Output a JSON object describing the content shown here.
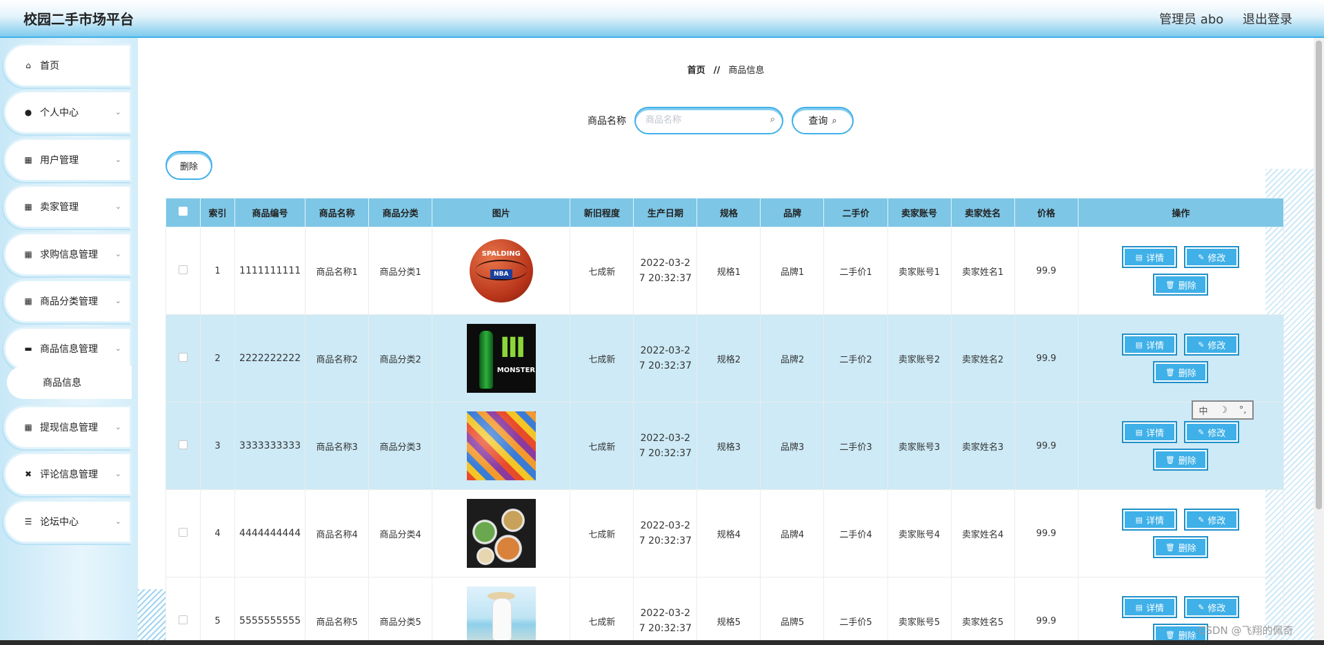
{
  "header": {
    "app_title": "校园二手市场平台",
    "user_label": "管理员 abo",
    "logout_label": "退出登录"
  },
  "sidebar": {
    "items": [
      {
        "label": "首页",
        "icon": "home-icon",
        "glyph": "⌂",
        "has_chevron": false
      },
      {
        "label": "个人中心",
        "icon": "person-icon",
        "glyph": "●",
        "has_chevron": true
      },
      {
        "label": "用户管理",
        "icon": "grid-icon",
        "glyph": "▦",
        "has_chevron": true
      },
      {
        "label": "卖家管理",
        "icon": "grid-icon",
        "glyph": "▦",
        "has_chevron": true
      },
      {
        "label": "求购信息管理",
        "icon": "grid-icon",
        "glyph": "▦",
        "has_chevron": true
      },
      {
        "label": "商品分类管理",
        "icon": "grid-icon",
        "glyph": "▦",
        "has_chevron": true
      },
      {
        "label": "商品信息管理",
        "icon": "chat-icon",
        "glyph": "▬",
        "has_chevron": true
      },
      {
        "label": "提现信息管理",
        "icon": "grid-icon",
        "glyph": "▦",
        "has_chevron": true
      },
      {
        "label": "评论信息管理",
        "icon": "ticket-icon",
        "glyph": "✖",
        "has_chevron": true
      },
      {
        "label": "论坛中心",
        "icon": "list-icon",
        "glyph": "☰",
        "has_chevron": true
      }
    ],
    "sub_item": "商品信息"
  },
  "breadcrumb": {
    "home": "首页",
    "separator": "//",
    "current": "商品信息"
  },
  "search": {
    "label": "商品名称",
    "placeholder": "商品名称",
    "value": "",
    "button_label": "查询"
  },
  "toolbar": {
    "delete_label": "删除"
  },
  "table": {
    "columns": [
      "索引",
      "商品编号",
      "商品名称",
      "商品分类",
      "图片",
      "新旧程度",
      "生产日期",
      "规格",
      "品牌",
      "二手价",
      "卖家账号",
      "卖家姓名",
      "价格",
      "操作"
    ],
    "actions": {
      "detail": "详情",
      "edit": "修改",
      "delete": "删除"
    },
    "rows": [
      {
        "index": "1",
        "code": "1111111111",
        "name": "商品名称1",
        "category": "商品分类1",
        "image": "basketball-image",
        "condition": "七成新",
        "date": "2022-03-27 20:32:37",
        "spec": "规格1",
        "brand": "品牌1",
        "used_price": "二手价1",
        "seller_account": "卖家账号1",
        "seller_name": "卖家姓名1",
        "price": "99.9"
      },
      {
        "index": "2",
        "code": "2222222222",
        "name": "商品名称2",
        "category": "商品分类2",
        "image": "energy-drink-image",
        "condition": "七成新",
        "date": "2022-03-27 20:32:37",
        "spec": "规格2",
        "brand": "品牌2",
        "used_price": "二手价2",
        "seller_account": "卖家账号2",
        "seller_name": "卖家姓名2",
        "price": "99.9"
      },
      {
        "index": "3",
        "code": "3333333333",
        "name": "商品名称3",
        "category": "商品分类3",
        "image": "snacks-image",
        "condition": "七成新",
        "date": "2022-03-27 20:32:37",
        "spec": "规格3",
        "brand": "品牌3",
        "used_price": "二手价3",
        "seller_account": "卖家账号3",
        "seller_name": "卖家姓名3",
        "price": "99.9"
      },
      {
        "index": "4",
        "code": "4444444444",
        "name": "商品名称4",
        "category": "商品分类4",
        "image": "food-bowls-image",
        "condition": "七成新",
        "date": "2022-03-27 20:32:37",
        "spec": "规格4",
        "brand": "品牌4",
        "used_price": "二手价4",
        "seller_account": "卖家账号4",
        "seller_name": "卖家姓名4",
        "price": "99.9"
      },
      {
        "index": "5",
        "code": "5555555555",
        "name": "商品名称5",
        "category": "商品分类5",
        "image": "beach-dress-image",
        "condition": "七成新",
        "date": "2022-03-27 20:32:37",
        "spec": "规格5",
        "brand": "品牌5",
        "used_price": "二手价5",
        "seller_account": "卖家账号5",
        "seller_name": "卖家姓名5",
        "price": "99.9"
      }
    ]
  },
  "image_text": {
    "ball_brand": "SPALDING",
    "ball_league": "NBA",
    "drink_brand": "MONSTER"
  },
  "ime_toolbar": {
    "lang": "中",
    "moon": "☽",
    "punct": "°,"
  },
  "watermark": "CSDN @飞翔的佩奇",
  "colors": {
    "accent": "#3fb0e8",
    "table_header": "#7dc6e6",
    "row_alt": "#cdeaf6"
  }
}
